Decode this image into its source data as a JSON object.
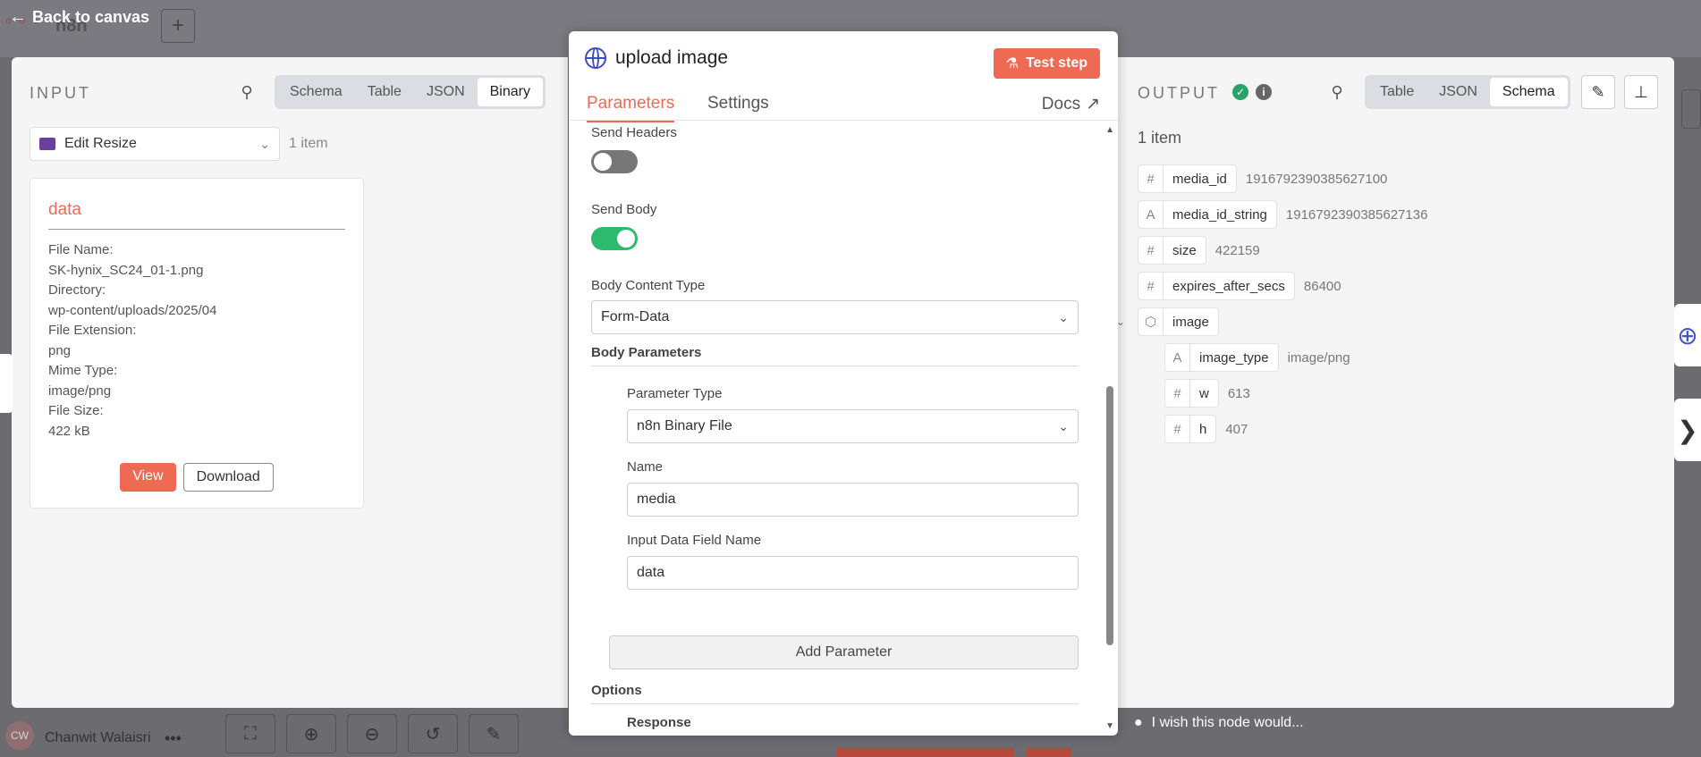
{
  "canvas": {
    "back_label": "Back to canvas",
    "workflow_name": "n8n",
    "user_initials": "CW",
    "user_name": "Chanwit Walaisri"
  },
  "input": {
    "title": "INPUT",
    "views": [
      "Schema",
      "Table",
      "JSON",
      "Binary"
    ],
    "active_view": "Binary",
    "node_select": "Edit Resize",
    "item_count": "1 item",
    "binary": {
      "title": "data",
      "rows": [
        "File Name:",
        "SK-hynix_SC24_01-1.png",
        "Directory:",
        "wp-content/uploads/2025/04",
        "File Extension:",
        "png",
        "Mime Type:",
        "image/png",
        "File Size:",
        "422 kB"
      ],
      "view_label": "View",
      "download_label": "Download"
    }
  },
  "node": {
    "title": "upload image",
    "test_label": "Test step",
    "tabs": [
      "Parameters",
      "Settings"
    ],
    "docs_label": "Docs",
    "send_headers_label": "Send Headers",
    "send_headers": false,
    "send_body_label": "Send Body",
    "send_body": true,
    "body_content_type_label": "Body Content Type",
    "body_content_type": "Form-Data",
    "body_parameters_label": "Body Parameters",
    "parameter_type_label": "Parameter Type",
    "parameter_type": "n8n Binary File",
    "name_label": "Name",
    "name_value": "media",
    "input_field_label": "Input Data Field Name",
    "input_field_value": "data",
    "add_parameter_label": "Add Parameter",
    "options_label": "Options",
    "response_label": "Response"
  },
  "output": {
    "title": "OUTPUT",
    "views": [
      "Table",
      "JSON",
      "Schema"
    ],
    "active_view": "Schema",
    "item_count": "1 item",
    "schema": [
      {
        "type": "#",
        "key": "media_id",
        "value": "1916792390385627100"
      },
      {
        "type": "A",
        "key": "media_id_string",
        "value": "1916792390385627136"
      },
      {
        "type": "#",
        "key": "size",
        "value": "422159"
      },
      {
        "type": "#",
        "key": "expires_after_secs",
        "value": "86400"
      },
      {
        "type": "obj",
        "key": "image",
        "value": ""
      },
      {
        "type": "A",
        "key": "image_type",
        "value": "image/png"
      },
      {
        "type": "#",
        "key": "w",
        "value": "613"
      },
      {
        "type": "#",
        "key": "h",
        "value": "407"
      }
    ],
    "wish_label": "I wish this node would..."
  },
  "colors": {
    "accent": "#ee6a53",
    "success": "#29a36a",
    "toggle_on": "#2eba6e",
    "node_icon": "#3d4cc8"
  }
}
